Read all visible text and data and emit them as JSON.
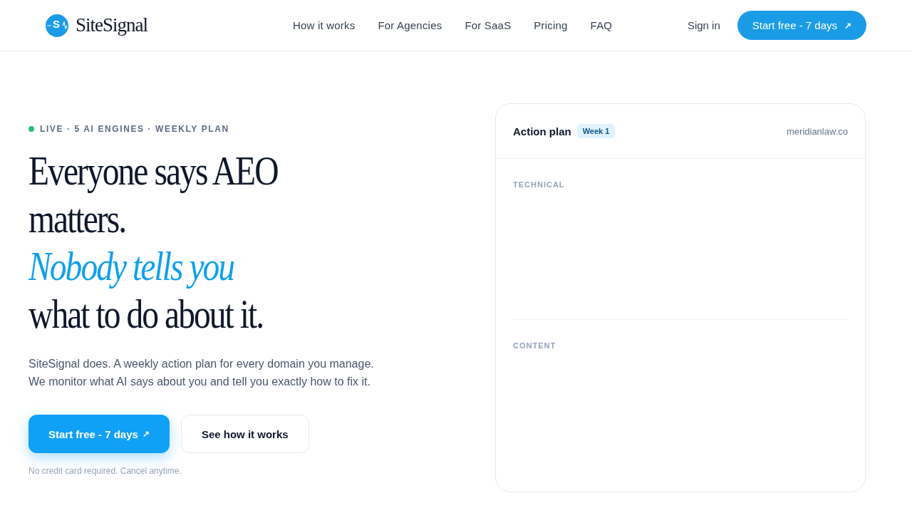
{
  "header": {
    "logo": {
      "mark": "S",
      "name": "SiteSignal"
    },
    "nav": [
      "How it works",
      "For Agencies",
      "For SaaS",
      "Pricing",
      "FAQ"
    ],
    "sign_in": "Sign in",
    "cta": {
      "label": "Start free - 7 days",
      "icon": "↗"
    }
  },
  "hero": {
    "eyebrow": {
      "color": "#22c07a",
      "text": "LIVE · 5 AI ENGINES · WEEKLY PLAN"
    },
    "headline": [
      {
        "text": "Everyone says AEO",
        "kind": "plain"
      },
      {
        "text": "matters.",
        "kind": "plain"
      },
      {
        "text": "Nobody tells you",
        "kind": "accent"
      },
      {
        "text": "what to do about it.",
        "kind": "plain"
      }
    ],
    "description": [
      "SiteSignal does. A weekly action plan for every domain you manage.",
      "We monitor what AI says about you and tell you exactly how to fix it."
    ],
    "buttons": [
      {
        "label": "Start free - 7 days",
        "icon": "↗",
        "kind": "primary"
      },
      {
        "label": "See how it works",
        "kind": "secondary"
      }
    ],
    "note": "No credit card required. Cancel anytime."
  },
  "action_plan": {
    "title": "Action plan",
    "badge": "Week 1",
    "domain": "meridianlaw.co",
    "sections": [
      "TECHNICAL",
      "CONTENT"
    ]
  }
}
